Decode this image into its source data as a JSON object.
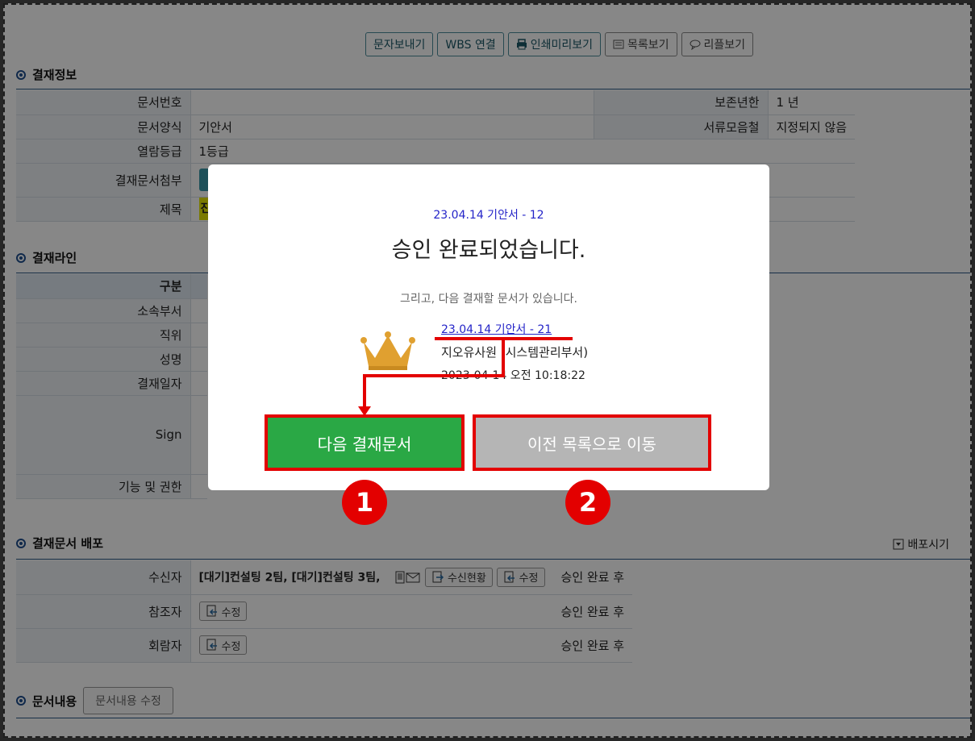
{
  "toolbar": {
    "sms": "문자보내기",
    "wbs": "WBS 연결",
    "print": "인쇄미리보기",
    "list": "목록보기",
    "reply": "리플보기"
  },
  "approval_info": {
    "header": "결재정보",
    "doc_no_label": "문서번호",
    "doc_no_value": "",
    "retention_label": "보존년한",
    "retention_value": "1 년",
    "form_label": "문서양식",
    "form_value": "기안서",
    "folder_label": "서류모음철",
    "folder_value": "지정되지 않음",
    "grade_label": "열람등급",
    "grade_value": "1등급",
    "attach_label": "결재문서첨부",
    "subject_label": "제목",
    "subject_partial": "진"
  },
  "approval_line": {
    "header": "결재라인",
    "rows": [
      "구분",
      "소속부서",
      "직위",
      "성명",
      "결재일자",
      "Sign",
      "기능 및 권한"
    ]
  },
  "distribution": {
    "header": "결재문서 배포",
    "distribute_btn": "배포시기",
    "recipient_label": "수신자",
    "recipient_value": "[대기]컨설팅 2팀,  [대기]컨설팅 3팀,",
    "status_btn": "수신현황",
    "edit": "수정",
    "cc_label": "참조자",
    "circ_label": "회람자",
    "after_approval": "승인 완료 후"
  },
  "content": {
    "header": "문서내용",
    "edit_btn": "문서내용 수정"
  },
  "modal": {
    "ref": "23.04.14 기안서 - 12",
    "title": "승인 완료되었습니다.",
    "sub": "그리고, 다음 결재할 문서가 있습니다.",
    "next_doc": "23.04.14 기안서 - 21",
    "person": "지오유사원 (시스템관리부서)",
    "time": "2023-04-14 오전 10:18:22",
    "btn_next": "다음 결재문서",
    "btn_prev": "이전 목록으로 이동"
  },
  "annotations": {
    "one": "1",
    "two": "2"
  },
  "colors": {
    "next_btn": "#2aa845",
    "prev_btn": "#b5b5b5",
    "highlight": "#e30000",
    "link": "#2424c8"
  }
}
